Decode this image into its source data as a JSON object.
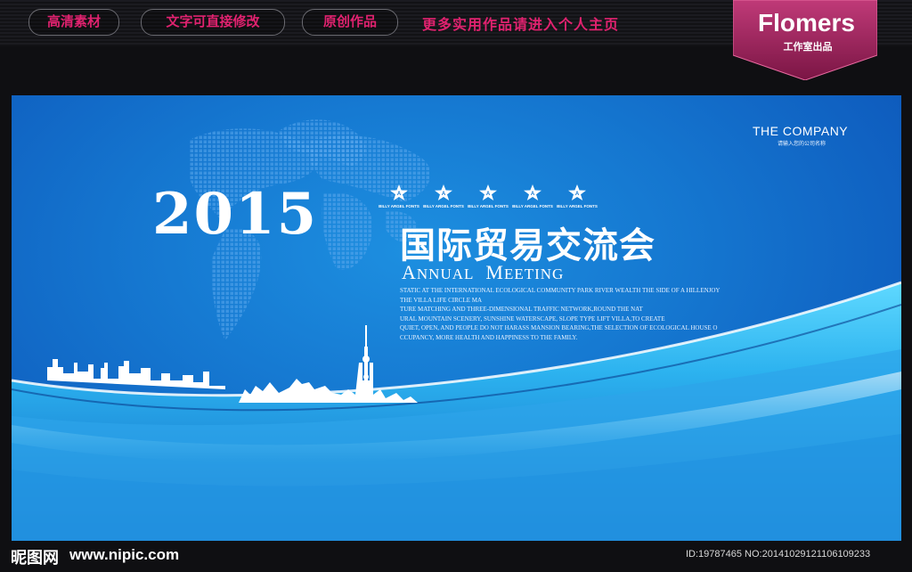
{
  "topbar": {
    "tags": [
      "高清素材",
      "文字可直接修改",
      "原创作品"
    ],
    "promo": "更多实用作品请进入个人主页"
  },
  "brand": {
    "name": "Flomers",
    "sub": "工作室出品",
    "color": "#a0245e"
  },
  "banner": {
    "company": "THE COMPANY",
    "company_sub": "请输入您的公司名称",
    "year": "2015",
    "title_cn": "国际贸易交流会",
    "annual_big_a": "A",
    "annual_rest1": "NNUAL",
    "annual_big_m": "M",
    "annual_rest2": "EETING",
    "stars": [
      "BILLY ARGEL FONTS",
      "BILLY ARGEL FONTS",
      "BILLY ARGEL FONTS",
      "BILLY ARGEL FONTS",
      "BILLY ARGEL FONTS"
    ],
    "desc_lines": [
      "STATIC AT THE INTERNATIONAL ECOLOGICAL COMMUNITY PARK RIVER WEALTH THE SIDE OF A HILLENJOY",
      "THE VILLA LIFE CIRCLE MA",
      "TURE MATCHING AND THREE-DIMENSIONAL TRAFFIC NETWORK,ROUND THE NAT",
      "URAL MOUNTAIN SCENERY, SUNSHINE WATERSCAPE, SLOPE TYPE LIFT VILLA,TO CREATE",
      "QUIET, OPEN, AND PEOPLE DO NOT HARASS MANSION BEARING,THE SELECTION OF ECOLOGICAL HOUSE O",
      "CCUPANCY, MORE HEALTH AND HAPPINESS TO THE FAMILY."
    ],
    "colors": {
      "accent": "#1577d0",
      "wave": "#39c2f5"
    }
  },
  "footer": {
    "logo": "昵图网",
    "url": "www.nipic.com",
    "id": "ID:19787465 NO:20141029121106109233"
  }
}
